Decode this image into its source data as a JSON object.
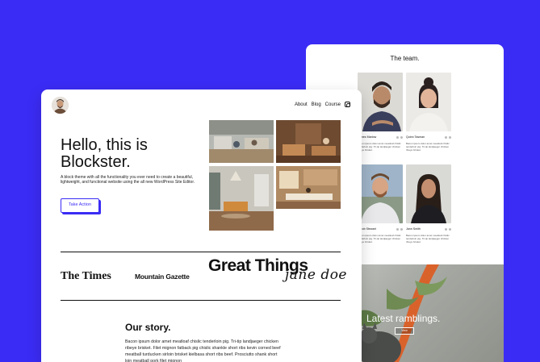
{
  "team_page": {
    "title": "The team.",
    "members": [
      {
        "name": "James Marlow",
        "bio": "Bacon ipsum dolor amet meatloaf chislic tenderloin pig. Tri-tip landjaeger chicken ribeye brisket."
      },
      {
        "name": "Quinn Tasman",
        "bio": "Bacon ipsum dolor amet meatloaf chislic tenderloin pig. Tri-tip landjaeger chicken ribeye brisket."
      },
      {
        "name": "Jacob Stewart",
        "bio": "Bacon ipsum dolor amet meatloaf chislic tenderloin pig. Tri-tip landjaeger chicken ribeye brisket."
      },
      {
        "name": "Jann Smith",
        "bio": "Bacon ipsum dolor amet meatloaf chislic tenderloin pig. Tri-tip landjaeger chicken ribeye brisket."
      }
    ],
    "ramblings": {
      "title": "Latest ramblings.",
      "button": "View"
    }
  },
  "home_page": {
    "nav": {
      "items": [
        "About",
        "Blog",
        "Course"
      ],
      "social_icon": "instagram-icon"
    },
    "hero": {
      "title": "Hello, this is Blockster.",
      "text": "A block theme with all the functionality you ever need to create a beautiful, lightweight, and functional website using the all new WordPress Site Editor.",
      "cta": "Take Action"
    },
    "logos": [
      "The Times",
      "Mountain Gazette",
      "Great Things",
      "jane doe"
    ],
    "story": {
      "title": "Our story.",
      "text": "Bacon ipsum dolor amet meatloaf chislic tenderloin pig. Tri-tip landjaeger chicken ribeye brisket. Filet mignon fatback pig chislic shankle short ribs kevin corned beef meatball turducken sirloin brisket kielbasa short ribs beef. Prosciutto shank short loin meatball pork filet mignon"
    }
  },
  "colors": {
    "background": "#3b2cf5",
    "accent": "#3b2cf5",
    "card": "#ffffff",
    "text": "#111111"
  }
}
